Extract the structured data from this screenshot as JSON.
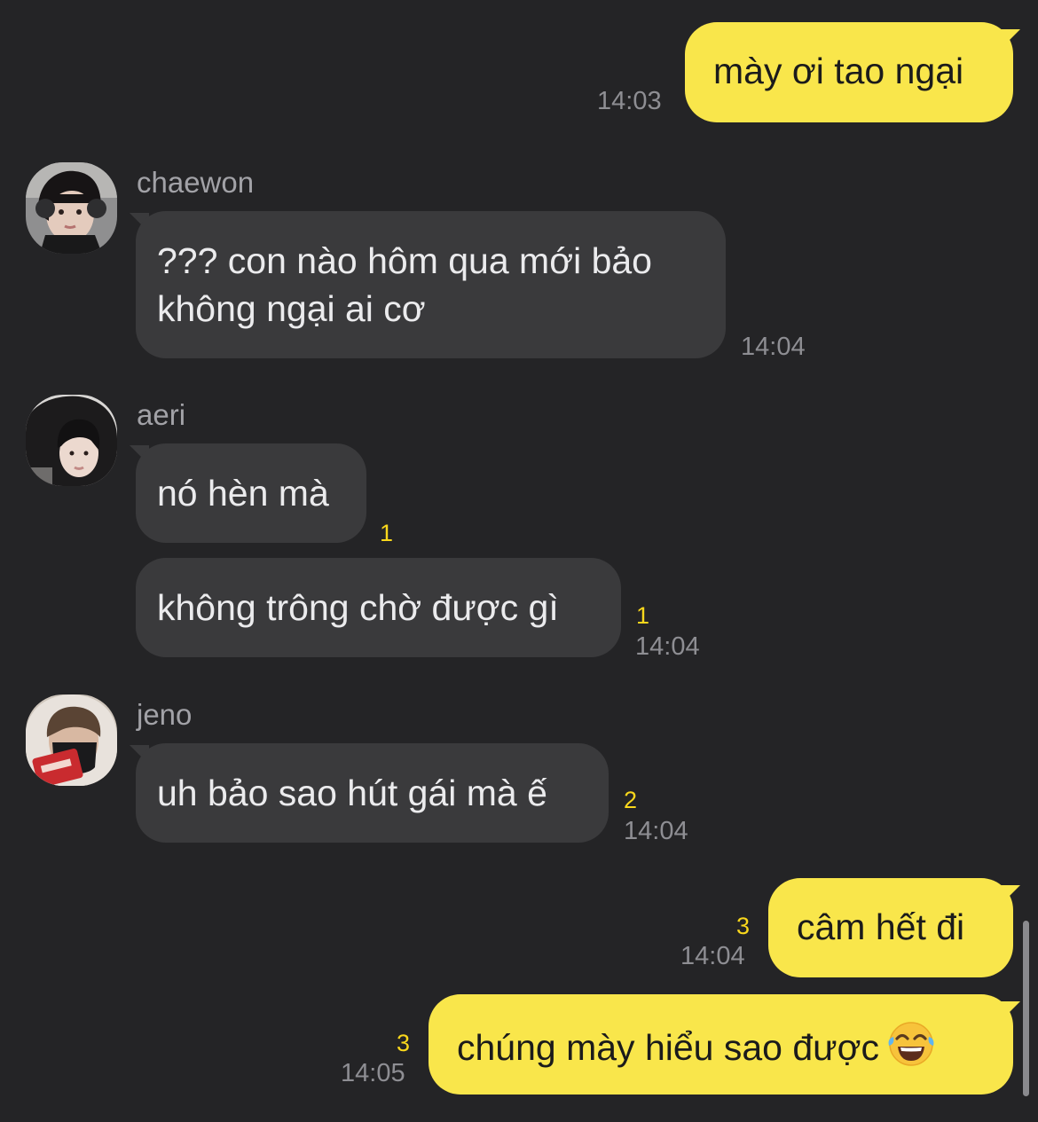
{
  "messages": {
    "m1": {
      "text": "mày ơi tao ngại",
      "time": "14:03"
    },
    "m2": {
      "sender": "chaewon",
      "line1": "??? con nào hôm qua mới bảo",
      "line2": "không ngại ai cơ",
      "time": "14:04"
    },
    "m3": {
      "sender": "aeri",
      "text": "nó hèn mà",
      "unread": "1"
    },
    "m4": {
      "text": "không trông chờ được gì",
      "unread": "1",
      "time": "14:04"
    },
    "m5": {
      "sender": "jeno",
      "text": "uh bảo sao hút gái mà ế",
      "unread": "2",
      "time": "14:04"
    },
    "m6": {
      "text": "câm hết đi",
      "unread": "3",
      "time": "14:04"
    },
    "m7": {
      "text": "chúng mày hiểu sao được",
      "emoji": "face-with-tears-of-joy",
      "unread": "3",
      "time": "14:05"
    }
  },
  "colors": {
    "background": "#242426",
    "incoming_bubble": "#3a3a3c",
    "outgoing_bubble": "#f9e64b",
    "unread_count": "#f9d71c",
    "timestamp": "#8e8e93"
  }
}
